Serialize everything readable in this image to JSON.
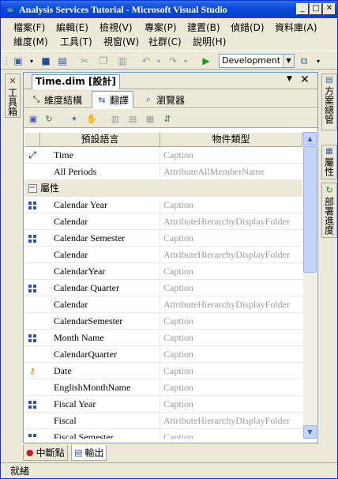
{
  "window": {
    "title": "Analysis Services Tutorial - Microsoft Visual Studio"
  },
  "menus": [
    {
      "label": "檔案(F)"
    },
    {
      "label": "編輯(E)"
    },
    {
      "label": "檢視(V)"
    },
    {
      "label": "專案(P)"
    },
    {
      "label": "建置(B)"
    },
    {
      "label": "偵錯(D)"
    },
    {
      "label": "資料庫(A)"
    },
    {
      "label": "維度(M)"
    },
    {
      "label": "工具(T)"
    },
    {
      "label": "視窗(W)"
    },
    {
      "label": "社群(C)"
    },
    {
      "label": "說明(H)"
    }
  ],
  "toolbar": {
    "configuration": "Development"
  },
  "side_panels": {
    "toolbox": "工具箱",
    "solution_explorer": "方案總管",
    "properties": "屬性",
    "deployment_progress": "部署進度"
  },
  "document": {
    "tab_title": "Time.dim [設計]",
    "designer_tabs": [
      {
        "label": "維度結構"
      },
      {
        "label": "翻譯"
      },
      {
        "label": "瀏覽器"
      }
    ]
  },
  "grid": {
    "headers": [
      "預設語言",
      "物件類型"
    ],
    "rows": [
      {
        "icon": "dimension-icon",
        "name": "Time",
        "type": "Caption"
      },
      {
        "icon": "",
        "name": "All Periods",
        "type": "AttributeAllMemberName"
      },
      {
        "icon": "collapse-icon",
        "name": "屬性",
        "type": "",
        "group": true
      },
      {
        "icon": "attribute-icon",
        "name": "Calendar Year",
        "type": "Caption"
      },
      {
        "icon": "",
        "name": "Calendar",
        "type": "AttributeHierarchyDisplayFolder"
      },
      {
        "icon": "attribute-icon",
        "name": "Calendar Semester",
        "type": "Caption"
      },
      {
        "icon": "",
        "name": "Calendar",
        "type": "AttributeHierarchyDisplayFolder"
      },
      {
        "icon": "",
        "name": "CalendarYear",
        "type": "Caption"
      },
      {
        "icon": "attribute-icon",
        "name": "Calendar Quarter",
        "type": "Caption"
      },
      {
        "icon": "",
        "name": "Calendar",
        "type": "AttributeHierarchyDisplayFolder"
      },
      {
        "icon": "",
        "name": "CalendarSemester",
        "type": "Caption"
      },
      {
        "icon": "attribute-icon",
        "name": "Month Name",
        "type": "Caption"
      },
      {
        "icon": "",
        "name": "CalendarQuarter",
        "type": "Caption"
      },
      {
        "icon": "key-attribute-icon",
        "name": "Date",
        "type": "Caption"
      },
      {
        "icon": "",
        "name": "EnglishMonthName",
        "type": "Caption"
      },
      {
        "icon": "attribute-icon",
        "name": "Fiscal Year",
        "type": "Caption"
      },
      {
        "icon": "",
        "name": "Fiscal",
        "type": "AttributeHierarchyDisplayFolder"
      },
      {
        "icon": "attribute-icon",
        "name": "Fiscal Semester",
        "type": "Caption"
      }
    ]
  },
  "bottom_tabs": [
    {
      "label": "中斷點"
    },
    {
      "label": "輸出"
    }
  ],
  "status": {
    "text": "就緒"
  }
}
